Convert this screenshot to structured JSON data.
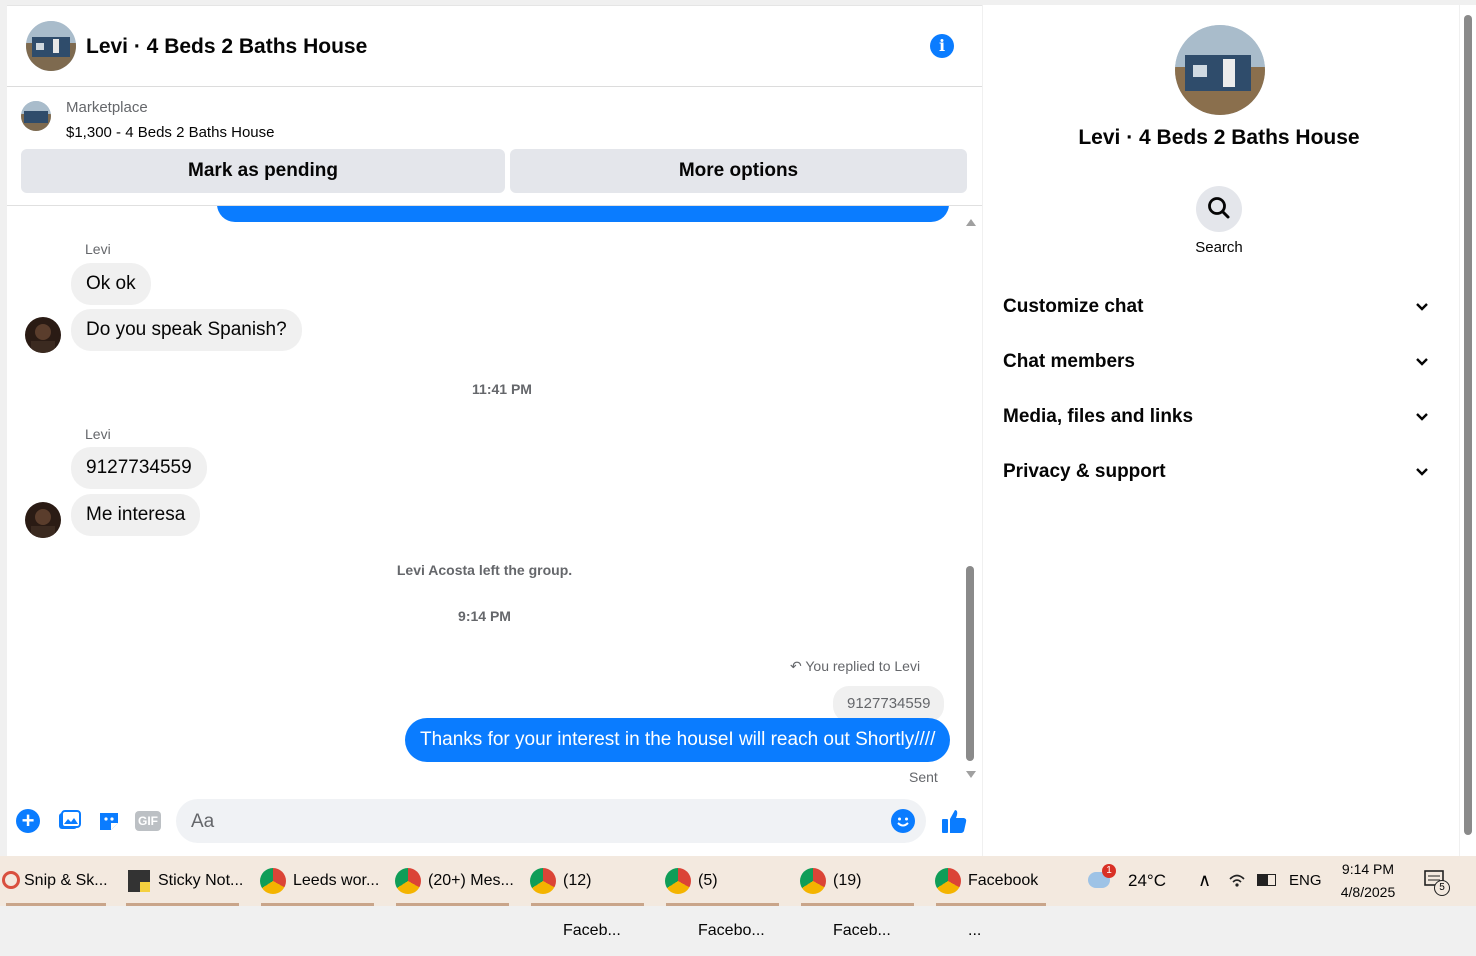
{
  "header": {
    "title": "Levi · 4 Beds 2 Baths House"
  },
  "marketplace": {
    "label": "Marketplace",
    "listing": "$1,300 - 4 Beds 2 Baths House",
    "mark_pending": "Mark as pending",
    "more_options": "More options"
  },
  "messages": {
    "sender1": "Levi",
    "msg1": "Ok ok",
    "msg2": "Do you speak Spanish?",
    "time1": "11:41 PM",
    "sender2": "Levi",
    "msg3": "9127734559",
    "msg4": "Me interesa",
    "event": "Levi Acosta left the group.",
    "time2": "9:14 PM",
    "replied_label": "You replied to Levi",
    "quoted": "9127734559",
    "outgoing": "Thanks for your interest in the houseI will reach out Shortly////",
    "status": "Sent"
  },
  "composer": {
    "placeholder": "Aa"
  },
  "details": {
    "title": "Levi · 4 Beds 2 Baths House",
    "search_label": "Search",
    "sections": [
      "Customize chat",
      "Chat members",
      "Media, files and links",
      "Privacy & support"
    ]
  },
  "taskbar": {
    "apps": [
      "Snip & Sk...",
      "Sticky Not...",
      "Leeds wor...",
      "(20+) Mes...",
      "(12) Faceb...",
      "(5) Facebo...",
      "(19) Faceb...",
      "Facebook ..."
    ],
    "weather_badge": "1",
    "temperature": "24°C",
    "language": "ENG",
    "time": "9:14 PM",
    "date": "4/8/2025",
    "notifications": "5"
  },
  "colors": {
    "accent": "#0a7cff",
    "bubble_in": "#f0f0f0",
    "taskbar": "#f3e9df"
  }
}
